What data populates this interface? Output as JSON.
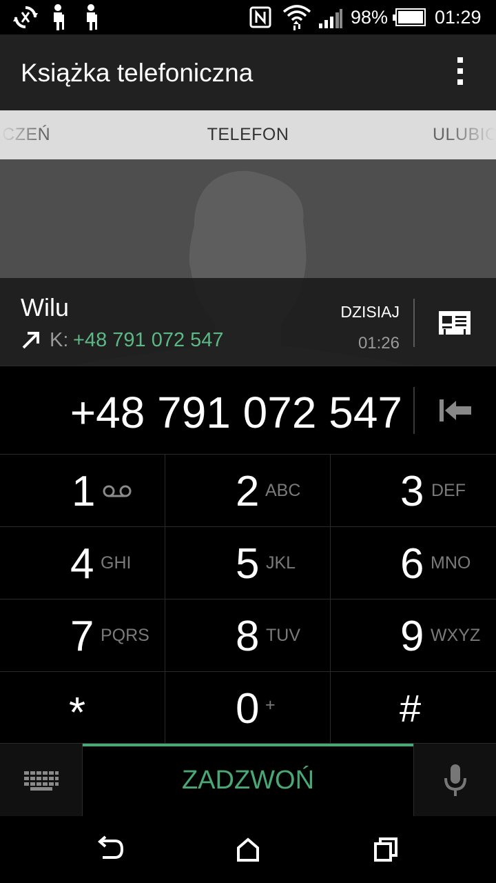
{
  "status_bar": {
    "battery": "98%",
    "time": "01:29",
    "icons": [
      "sync-icon",
      "accessibility-icon",
      "accessibility-icon",
      "nfc-icon",
      "wifi-icon",
      "signal-icon",
      "battery-icon"
    ]
  },
  "app_bar": {
    "title": "Książka telefoniczna"
  },
  "tabs": {
    "left": "ĄCZEŃ",
    "center": "TELEFON",
    "right": "ULUBIO"
  },
  "contact": {
    "name": "Wilu",
    "number_prefix": "K:",
    "number": "+48 791 072 547",
    "day": "DZISIAJ",
    "time": "01:26"
  },
  "dialer": {
    "number": "+48 791 072 547"
  },
  "keypad": [
    {
      "digit": "1",
      "letters": ""
    },
    {
      "digit": "2",
      "letters": "ABC"
    },
    {
      "digit": "3",
      "letters": "DEF"
    },
    {
      "digit": "4",
      "letters": "GHI"
    },
    {
      "digit": "5",
      "letters": "JKL"
    },
    {
      "digit": "6",
      "letters": "MNO"
    },
    {
      "digit": "7",
      "letters": "PQRS"
    },
    {
      "digit": "8",
      "letters": "TUV"
    },
    {
      "digit": "9",
      "letters": "WXYZ"
    },
    {
      "digit": "*",
      "letters": ""
    },
    {
      "digit": "0",
      "letters": "+"
    },
    {
      "digit": "#",
      "letters": ""
    }
  ],
  "call_button": {
    "label": "ZADZWOŃ"
  },
  "colors": {
    "accent": "#4aa876",
    "number_green": "#5cb884"
  }
}
